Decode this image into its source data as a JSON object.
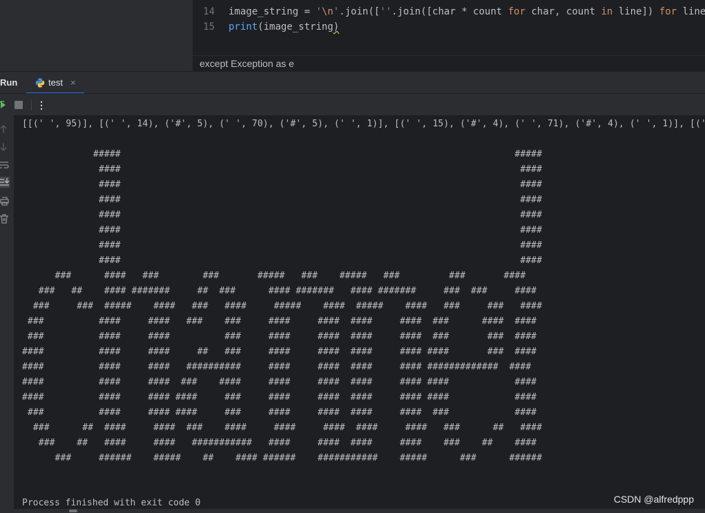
{
  "editor": {
    "lines": [
      {
        "number": "14",
        "tokens": [
          {
            "t": "image_string = ",
            "c": "plain"
          },
          {
            "t": "'",
            "c": "str"
          },
          {
            "t": "\\n",
            "c": "esc"
          },
          {
            "t": "'",
            "c": "str"
          },
          {
            "t": ".join([",
            "c": "plain"
          },
          {
            "t": "''",
            "c": "str"
          },
          {
            "t": ".join([char * count ",
            "c": "plain"
          },
          {
            "t": "for",
            "c": "kw"
          },
          {
            "t": " char, count ",
            "c": "plain"
          },
          {
            "t": "in",
            "c": "kw"
          },
          {
            "t": " line]) ",
            "c": "plain"
          },
          {
            "t": "for",
            "c": "kw"
          },
          {
            "t": " line ",
            "c": "plain"
          },
          {
            "t": "in",
            "c": "kw"
          }
        ]
      },
      {
        "number": "15",
        "tokens": [
          {
            "t": "print",
            "c": "fn"
          },
          {
            "t": "(image_string",
            "c": "plain"
          },
          {
            "t": ")",
            "c": "plain squig"
          }
        ]
      }
    ],
    "breadcrumb": "except Exception as e"
  },
  "run_panel": {
    "title": "Run",
    "tab_label": "test",
    "tab_close": "×",
    "more_label": "⋮"
  },
  "icons": {
    "up": "arrow-up-icon",
    "down": "arrow-down-icon",
    "wrap": "soft-wrap-icon",
    "scroll_end": "scroll-to-end-icon",
    "print": "print-icon",
    "trash": "trash-icon",
    "rerun": "rerun-icon",
    "stop": "stop-icon",
    "python": "python-file-icon"
  },
  "console": {
    "output": "[[(' ', 95)], [(' ', 14), ('#', 5), (' ', 70), ('#', 5), (' ', 1)], [(' ', 15), ('#', 4), (' ', 71), ('#', 4), (' ', 1)], [(' ', 1",
    "art_lines": [
      "",
      "             #####                                                                        #####",
      "              ####                                                                         ####",
      "              ####                                                                         ####",
      "              ####                                                                         ####",
      "              ####                                                                         ####",
      "              ####                                                                         ####",
      "              ####                                                                         ####",
      "              ####                                                                         ####",
      "      ###      ####   ###        ###       #####   ###    #####   ###         ###       ####",
      "   ###   ##    #### #######     ##  ###      #### #######   #### #######     ###  ###     ####",
      "  ###     ###  #####    ####   ###   ####     #####    ####  #####    ####   ###     ###   ####",
      " ###          ####     ####   ###    ###     ####     ####  ####     ####  ###      ####  ####",
      " ###          ####     ####          ###     ####     ####  ####     ####  ###       ###  ####",
      "####          ####     ####     ##   ###     ####     ####  ####     #### ####       ###  ####",
      "####          ####     ####   ##########     ####     ####  ####     #### #############  ####",
      "####          ####     ####  ###    ####     ####     ####  ####     #### ####            ####",
      "####          ####     #### ####     ###     ####     ####  ####     #### ####            ####",
      " ###          ####     #### ####     ###     ####     ####  ####     ####  ###            ####",
      "  ###      ##  ####     ####  ###    ####     ####     ####  ####     ####   ###      ##   ####",
      "   ###    ##   ####     ####   ###########   ####     ####  ####     ####    ###    ##    ####",
      "      ###     ######    #####    ##    #### ######    ###########    #####      ###      ######"
    ],
    "finished": "Process finished with exit code 0"
  },
  "watermark": "CSDN @alfredppp"
}
